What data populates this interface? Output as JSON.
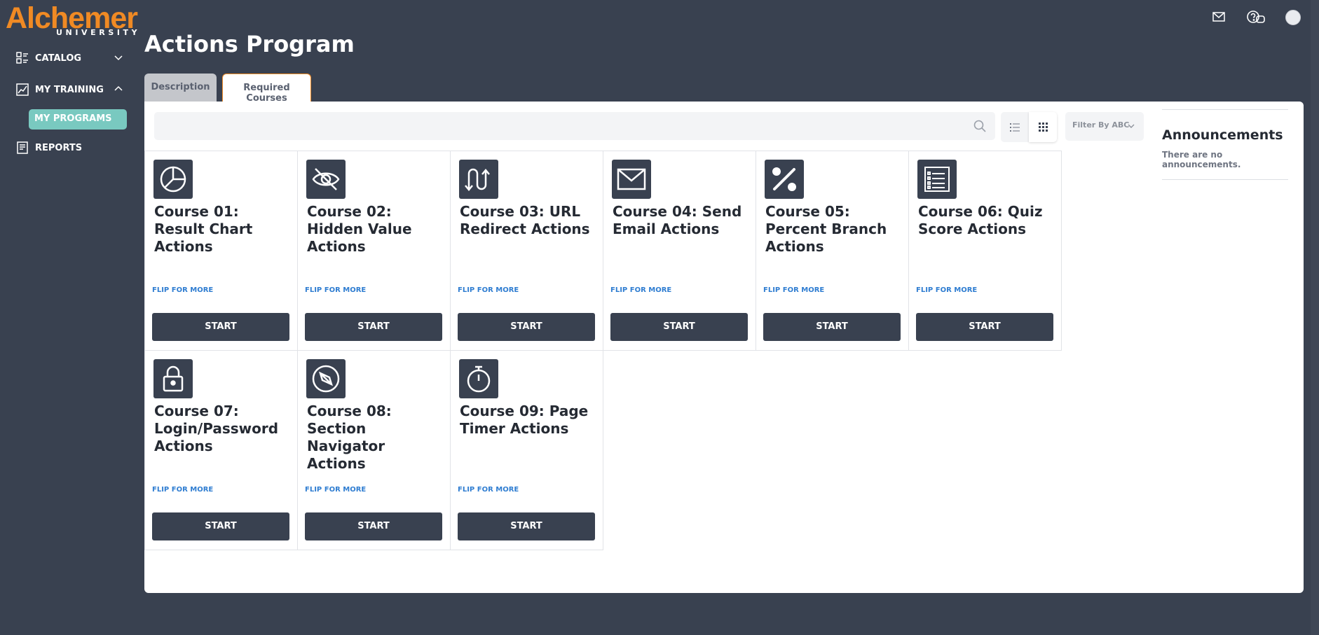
{
  "brand": {
    "name": "Alchemer",
    "sub": "UNIVERSITY",
    "color": "#f08a24"
  },
  "sidebar": {
    "catalog": {
      "label": "CATALOG",
      "icon": "catalog-icon"
    },
    "my_training": {
      "label": "MY TRAINING",
      "icon": "chart-line-icon"
    },
    "my_programs": {
      "label": "MY PROGRAMS"
    },
    "reports": {
      "label": "REPORTS",
      "icon": "report-icon"
    }
  },
  "header": {
    "icons": [
      "mail-icon",
      "help-chat-icon",
      "avatar"
    ]
  },
  "page": {
    "title": "Actions Program"
  },
  "tabs": [
    {
      "label": "Description",
      "active": false
    },
    {
      "label": "Required Courses",
      "active": true
    }
  ],
  "toolbar": {
    "search_placeholder": "",
    "filter_label": "Filter By ABC"
  },
  "courses": [
    {
      "title": "Course 01: Result Chart Actions",
      "icon": "pie-chart-icon",
      "flip": "FLIP FOR MORE",
      "start": "START"
    },
    {
      "title": "Course 02: Hidden Value Actions",
      "icon": "eye-slash-icon",
      "flip": "FLIP FOR MORE",
      "start": "START"
    },
    {
      "title": "Course 03: URL Redirect Actions",
      "icon": "redirect-arrows-icon",
      "flip": "FLIP FOR MORE",
      "start": "START"
    },
    {
      "title": "Course 04: Send Email Actions",
      "icon": "envelope-icon",
      "flip": "FLIP FOR MORE",
      "start": "START"
    },
    {
      "title": "Course 05: Percent Branch Actions",
      "icon": "percent-icon",
      "flip": "FLIP FOR MORE",
      "start": "START"
    },
    {
      "title": "Course 06: Quiz Score Actions",
      "icon": "checklist-icon",
      "flip": "FLIP FOR MORE",
      "start": "START"
    },
    {
      "title": "Course 07: Login/Password Actions",
      "icon": "lock-icon",
      "flip": "FLIP FOR MORE",
      "start": "START"
    },
    {
      "title": "Course 08: Section Navigator Actions",
      "icon": "compass-icon",
      "flip": "FLIP FOR MORE",
      "start": "START"
    },
    {
      "title": "Course 09: Page Timer Actions",
      "icon": "stopwatch-icon",
      "flip": "FLIP FOR MORE",
      "start": "START"
    }
  ],
  "announcements": {
    "title": "Announcements",
    "empty_text": "There are no announcements."
  }
}
